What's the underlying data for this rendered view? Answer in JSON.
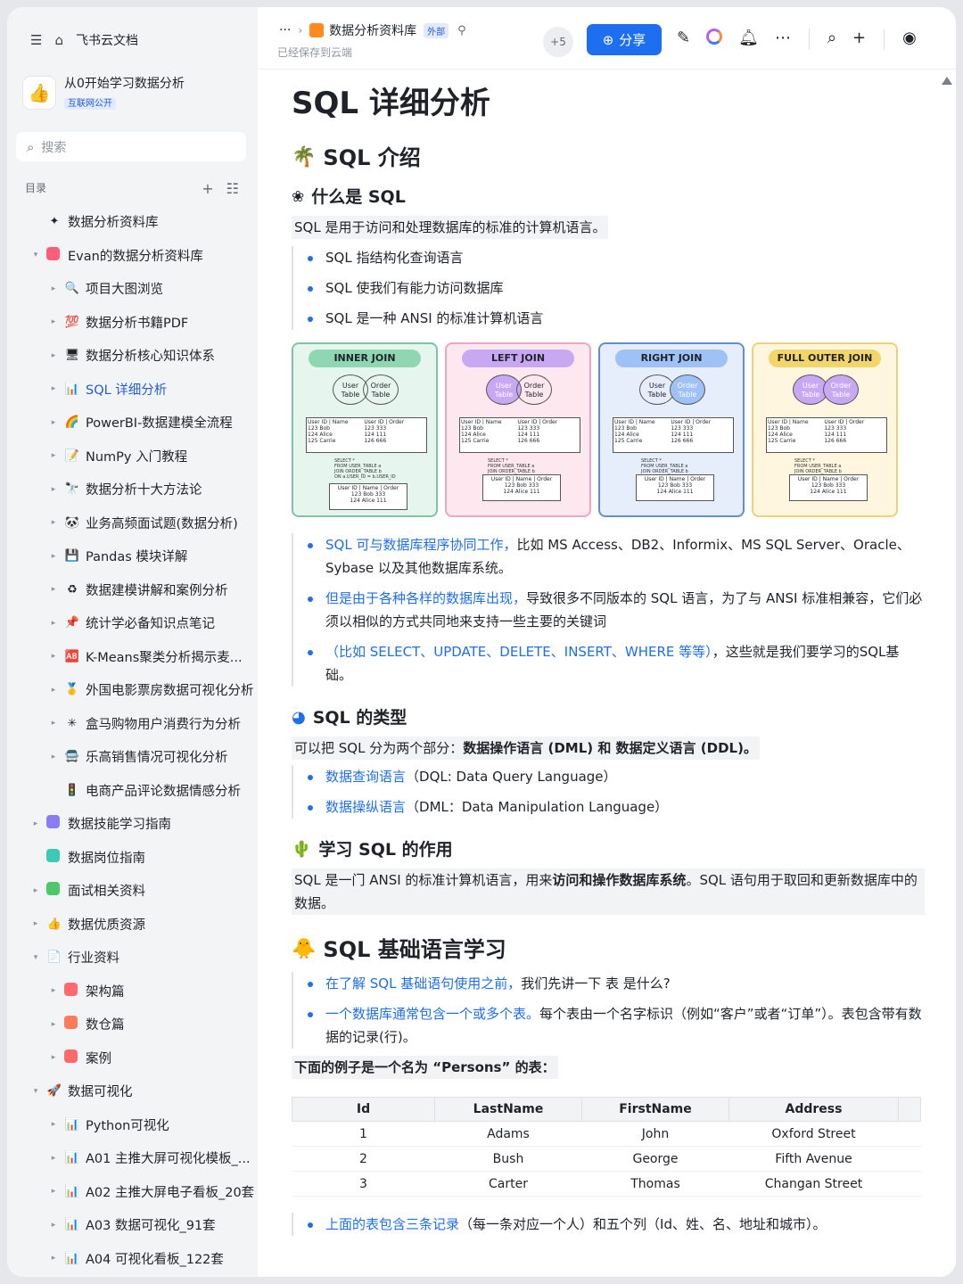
{
  "sidebar": {
    "home_label": "飞书云文档",
    "workspace": {
      "name": "从0开始学习数据分析",
      "badge": "互联网公开"
    },
    "search_placeholder": "搜索",
    "toc_title": "目录",
    "items": [
      {
        "label": "数据分析资料库",
        "level": 0,
        "caret": "",
        "icon": "✦"
      },
      {
        "label": "Evan的数据分析资料库",
        "level": 0,
        "caret": "▾",
        "icon": "sq:#ff5d7a"
      },
      {
        "label": "项目大图浏览",
        "level": 1,
        "caret": "▸",
        "icon": "🔍"
      },
      {
        "label": "数据分析书籍PDF",
        "level": 1,
        "caret": "▸",
        "icon": "💯"
      },
      {
        "label": "数据分析核心知识体系",
        "level": 1,
        "caret": "▸",
        "icon": "🖥"
      },
      {
        "label": "SQL 详细分析",
        "level": 1,
        "caret": "▸",
        "icon": "📊",
        "active": true
      },
      {
        "label": "PowerBI-数据建模全流程",
        "level": 1,
        "caret": "▸",
        "icon": "🌈"
      },
      {
        "label": "NumPy 入门教程",
        "level": 1,
        "caret": "▸",
        "icon": "📝"
      },
      {
        "label": "数据分析十大方法论",
        "level": 1,
        "caret": "▸",
        "icon": "🔭"
      },
      {
        "label": "业务高频面试题(数据分析)",
        "level": 1,
        "caret": "▸",
        "icon": "🐼"
      },
      {
        "label": "Pandas 模块详解",
        "level": 1,
        "caret": "▸",
        "icon": "💾"
      },
      {
        "label": "数据建模讲解和案例分析",
        "level": 1,
        "caret": "▸",
        "icon": "♻"
      },
      {
        "label": "统计学必备知识点笔记",
        "level": 1,
        "caret": "▸",
        "icon": "📌"
      },
      {
        "label": "K-Means聚类分析揭示麦...",
        "level": 1,
        "caret": "▸",
        "icon": "🆎"
      },
      {
        "label": "外国电影票房数据可视化分析",
        "level": 1,
        "caret": "▸",
        "icon": "🥇"
      },
      {
        "label": "盒马购物用户消费行为分析",
        "level": 1,
        "caret": "▸",
        "icon": "✳"
      },
      {
        "label": "乐高销售情况可视化分析",
        "level": 1,
        "caret": "▸",
        "icon": "🚍"
      },
      {
        "label": "电商产品评论数据情感分析",
        "level": 1,
        "caret": "",
        "icon": "🚦"
      },
      {
        "label": "数据技能学习指南",
        "level": 0,
        "caret": "▸",
        "icon": "sq:#8a7cf5"
      },
      {
        "label": "数据岗位指南",
        "level": 0,
        "caret": "",
        "icon": "sq:#3cc9b5"
      },
      {
        "label": "面试相关资料",
        "level": 0,
        "caret": "▸",
        "icon": "sq:#4cc76c"
      },
      {
        "label": "数据优质资源",
        "level": 0,
        "caret": "▸",
        "icon": "👍"
      },
      {
        "label": "行业资料",
        "level": 0,
        "caret": "▾",
        "icon": "📄"
      },
      {
        "label": "架构篇",
        "level": 1,
        "caret": "▸",
        "icon": "sq:#ff6b6b"
      },
      {
        "label": "数仓篇",
        "level": 1,
        "caret": "▸",
        "icon": "sq:#ff7b5c"
      },
      {
        "label": "案例",
        "level": 1,
        "caret": "▸",
        "icon": "sq:#ff6b6b"
      },
      {
        "label": "数据可视化",
        "level": 0,
        "caret": "▾",
        "icon": "🚀"
      },
      {
        "label": "Python可视化",
        "level": 1,
        "caret": "▸",
        "icon": "📊"
      },
      {
        "label": "A01 主推大屏可视化模板_...",
        "level": 1,
        "caret": "▸",
        "icon": "📊"
      },
      {
        "label": "A02 主推大屏电子看板_20套",
        "level": 1,
        "caret": "▸",
        "icon": "📊"
      },
      {
        "label": "A03 数据可视化_91套",
        "level": 1,
        "caret": "▸",
        "icon": "📊"
      },
      {
        "label": "A04 可视化看板_122套",
        "level": 1,
        "caret": "▸",
        "icon": "📊"
      }
    ]
  },
  "topbar": {
    "more": "···",
    "doc_title": "数据分析资料库",
    "ext_badge": "外部",
    "saved": "已经保存到云端",
    "collaborators": "+5",
    "share_label": "分享"
  },
  "doc": {
    "title": "SQL 详细分析",
    "s1": {
      "heading": "SQL 介绍",
      "sub1": "什么是 SQL",
      "def": "SQL 是用于访问和处理数据库的标准的计算机语言。",
      "bullets": [
        "SQL 指结构化查询语言",
        "SQL 使我们有能力访问数据库",
        "SQL 是一种 ANSI 的标准计算机语言"
      ],
      "joins": [
        {
          "title": "INNER JOIN",
          "bg": "#e6f6ef",
          "border": "#7cc6a8",
          "pill": "#8fd6b3"
        },
        {
          "title": "LEFT JOIN",
          "bg": "#fde8ef",
          "border": "#f0a6bd",
          "pill": "#c9a8f3"
        },
        {
          "title": "RIGHT JOIN",
          "bg": "#e6eefc",
          "border": "#5f8fd6",
          "pill": "#9ec1f6"
        },
        {
          "title": "FULL OUTER JOIN",
          "bg": "#fff6df",
          "border": "#f2cf78",
          "pill": "#f2d66a"
        }
      ],
      "bullets2": [
        {
          "blue": "SQL 可与数据库程序协同工作，",
          "rest": "比如 MS Access、DB2、Informix、MS SQL Server、Oracle、Sybase 以及其他数据库系统。"
        },
        {
          "blue": "但是由于各种各样的数据库出现，",
          "rest": "导致很多不同版本的 SQL 语言，为了与 ANSI 标准相兼容，它们必须以相似的方式共同地来支持一些主要的关键词"
        },
        {
          "blue": "（比如 SELECT、UPDATE、DELETE、INSERT、WHERE 等等）",
          "rest": "，这些就是我们要学习的SQL基础。"
        }
      ]
    },
    "s2": {
      "heading": "SQL 的类型",
      "intro_a": "可以把 SQL 分为两个部分：",
      "intro_b": "数据操作语言 (DML) 和 数据定义语言 (DDL)。",
      "items": [
        {
          "blue": "数据查询语言",
          "rest": "（DQL: Data Query Language）"
        },
        {
          "blue": "数据操纵语言",
          "rest": "（DML：Data Manipulation Language）"
        }
      ]
    },
    "s3": {
      "heading": "学习 SQL 的作用",
      "p_a": "SQL 是一门 ANSI 的标准计算机语言，用来",
      "p_b": "访问和操作数据库系统",
      "p_c": "。SQL 语句用于取回和更新数据库中的数据。"
    },
    "s4": {
      "heading": "SQL 基础语言学习",
      "b1_blue": "在了解 SQL 基础语句使用之前，",
      "b1_rest": "我们先讲一下 表 是什么?",
      "b2_blue": "一个数据库通常包含一个或多个表。",
      "b2_rest": "每个表由一个名字标识（例如“客户”或者“订单”）。表包含带有数据的记录(行)。",
      "example": "下面的例子是一个名为 “Persons” 的表：",
      "table": {
        "headers": [
          "Id",
          "LastName",
          "FirstName",
          "Address"
        ],
        "rows": [
          [
            "1",
            "Adams",
            "John",
            "Oxford Street"
          ],
          [
            "2",
            "Bush",
            "George",
            "Fifth Avenue"
          ],
          [
            "3",
            "Carter",
            "Thomas",
            "Changan Street"
          ]
        ]
      },
      "last_blue": "上面的表包含三条记录",
      "last_rest": "（每一条对应一个人）和五个列（Id、姓、名、地址和城市）。"
    }
  }
}
